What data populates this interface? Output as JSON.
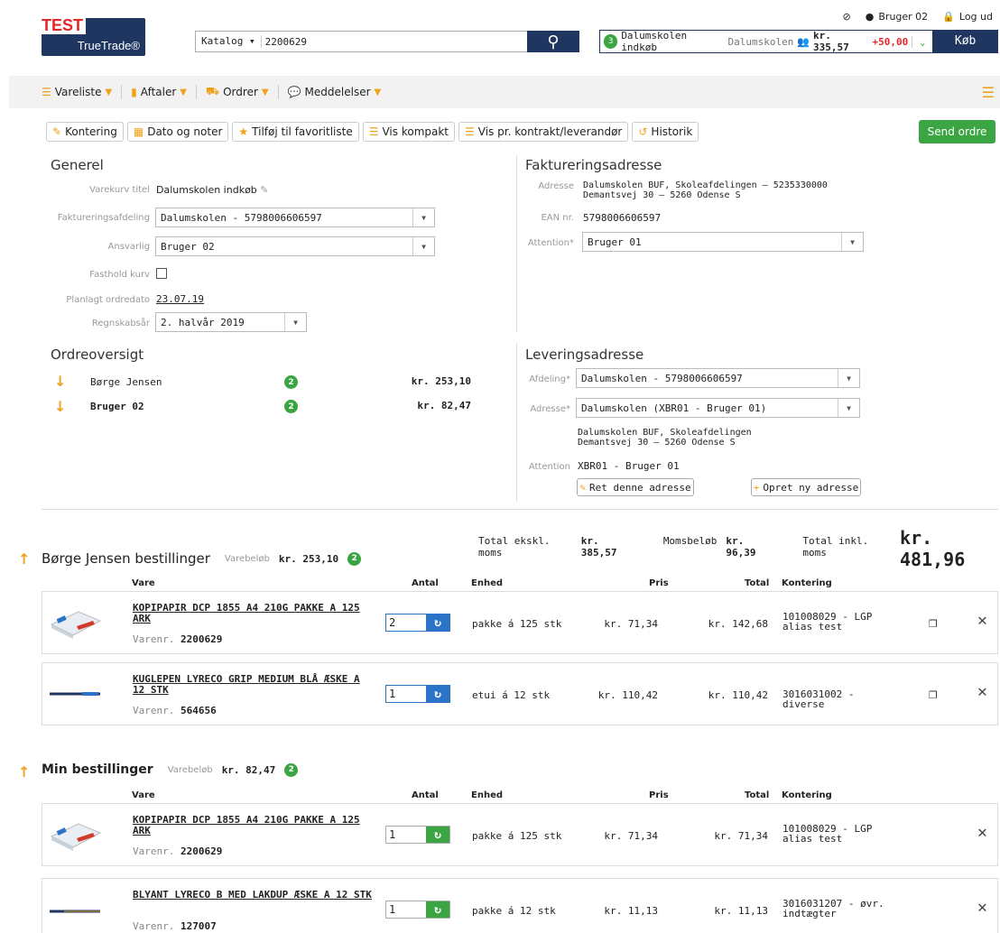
{
  "header": {
    "logo_test": "TEST",
    "logo_brand": "TrueTrade®",
    "user": "Bruger 02",
    "logout": "Log ud",
    "search_scope": "Katalog",
    "search_value": "2200629",
    "cart_count": "3",
    "cart_name": "Dalumskolen indkøb",
    "cart_org": "Dalumskolen",
    "cart_amount": "kr. 335,57",
    "cart_delta": "+50,00",
    "buy_label": "Køb"
  },
  "nav": {
    "items": [
      "Vareliste",
      "Aftaler",
      "Ordrer",
      "Meddelelser"
    ]
  },
  "toolbar": {
    "buttons": [
      "Kontering",
      "Dato og noter",
      "Tilføj til favoritliste",
      "Vis kompakt",
      "Vis pr. kontrakt/leverandør",
      "Historik"
    ],
    "send": "Send ordre"
  },
  "general": {
    "title": "Generel",
    "cart_title_label": "Varekurv titel",
    "cart_title_value": "Dalumskolen indkøb",
    "billing_dept_label": "Faktureringsafdeling",
    "billing_dept_value": "Dalumskolen - 5798006606597",
    "responsible_label": "Ansvarlig",
    "responsible_value": "Bruger 02",
    "keep_cart_label": "Fasthold kurv",
    "planned_date_label": "Planlagt ordredato",
    "planned_date_value": "23.07.19",
    "fiscal_year_label": "Regnskabsår",
    "fiscal_year_value": "2. halvår 2019"
  },
  "billing": {
    "title": "Faktureringsadresse",
    "address_label": "Adresse",
    "address_line1": "Dalumskolen  BUF, Skoleafdelingen —  5235330000",
    "address_line2": "Demantsvej 30  —  5260  Odense S",
    "ean_label": "EAN nr.",
    "ean_value": "5798006606597",
    "attention_label": "Attention*",
    "attention_value": "Bruger 01"
  },
  "overview": {
    "title": "Ordreoversigt",
    "rows": [
      {
        "name": "Børge Jensen",
        "count": "2",
        "amount": "kr. 253,10"
      },
      {
        "name": "Bruger 02",
        "count": "2",
        "amount": "kr. 82,47"
      }
    ]
  },
  "delivery": {
    "title": "Leveringsadresse",
    "dept_label": "Afdeling*",
    "dept_value": "Dalumskolen - 5798006606597",
    "address_label": "Adresse*",
    "address_value": "Dalumskolen (XBR01 - Bruger 01)",
    "address_line1": "Dalumskolen  BUF, Skoleafdelingen",
    "address_line2": "Demantsvej 30  —  5260  Odense S",
    "attention_label": "Attention",
    "attention_value": "XBR01 - Bruger 01",
    "edit_btn": "Ret denne adresse",
    "new_btn": "Opret ny adresse"
  },
  "totals": {
    "excl_label": "Total ekskl. moms",
    "excl_value": "kr. 385,57",
    "vat_label": "Momsbeløb",
    "vat_value": "kr. 96,39",
    "incl_label": "Total inkl. moms",
    "incl_value": "kr. 481,96"
  },
  "columns": {
    "vare": "Vare",
    "antal": "Antal",
    "enhed": "Enhed",
    "pris": "Pris",
    "total": "Total",
    "kontering": "Kontering"
  },
  "group1": {
    "title": "Børge Jensen bestillinger",
    "amount_label": "Varebeløb",
    "amount": "kr. 253,10",
    "count": "2",
    "lines": [
      {
        "name": "KOPIPAPIR DCP 1855 A4 210G PAKKE A 125 ARK",
        "varenr_label": "Varenr.",
        "varenr": "2200629",
        "qty": "2",
        "unit": "pakke á 125 stk",
        "price": "kr. 71,34",
        "total": "kr. 142,68",
        "kont1": "101008029 - LGP",
        "kont2": "alias test"
      },
      {
        "name": "KUGLEPEN LYRECO GRIP MEDIUM BLÅ ÆSKE A 12 STK",
        "varenr_label": "Varenr.",
        "varenr": "564656",
        "qty": "1",
        "unit": "etui á 12 stk",
        "price": "kr. 110,42",
        "total": "kr. 110,42",
        "kont1": "3016031002 - diverse",
        "kont2": ""
      }
    ]
  },
  "group2": {
    "title": "Min bestillinger",
    "amount_label": "Varebeløb",
    "amount": "kr. 82,47",
    "count": "2",
    "lines": [
      {
        "name": "KOPIPAPIR DCP 1855 A4 210G PAKKE A 125 ARK",
        "varenr_label": "Varenr.",
        "varenr": "2200629",
        "qty": "1",
        "unit": "pakke á 125 stk",
        "price": "kr. 71,34",
        "total": "kr. 71,34",
        "kont1": "101008029 - LGP",
        "kont2": "alias test"
      },
      {
        "name": "BLYANT LYRECO B MED LAKDUP ÆSKE A 12 STK",
        "varenr_label": "Varenr.",
        "varenr": "127007",
        "qty": "1",
        "unit": "pakke á 12 stk",
        "price": "kr. 11,13",
        "total": "kr. 11,13",
        "kont1": "3016031207 - øvr.",
        "kont2": "indtægter"
      }
    ]
  },
  "colors": {
    "navy": "#1f3660",
    "green": "#3aa542",
    "orange": "#f0a11a",
    "blue": "#2a73c7",
    "red": "#e3282b"
  }
}
